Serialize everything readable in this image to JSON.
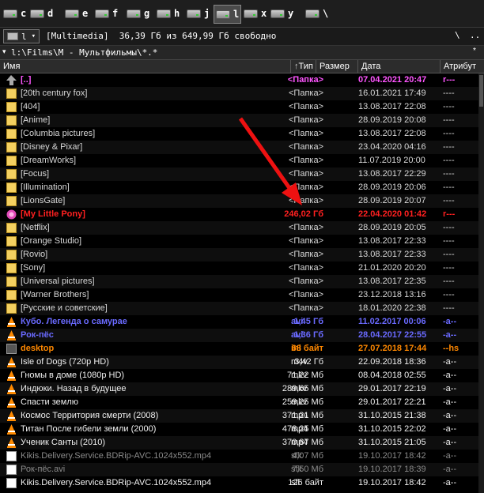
{
  "drives": [
    {
      "letter": "c",
      "active": false
    },
    {
      "letter": "d",
      "active": false
    },
    {
      "letter": "e",
      "active": false
    },
    {
      "letter": "f",
      "active": false
    },
    {
      "letter": "g",
      "active": false
    },
    {
      "letter": "h",
      "active": false
    },
    {
      "letter": "j",
      "active": false
    },
    {
      "letter": "l",
      "active": true
    },
    {
      "letter": "x",
      "active": false
    },
    {
      "letter": "y",
      "active": false
    },
    {
      "letter": "\\",
      "active": false
    }
  ],
  "pathbar": {
    "drive": "l",
    "volume": "[Multimedia]  36,39 Гб из 649,99 Гб свободно",
    "buttons": [
      "\\",
      ".."
    ]
  },
  "current_path": "l:\\Films\\М - Мультфильмы\\*.*",
  "headers": {
    "name": "Имя",
    "ext": "Тип",
    "size": "Размер",
    "date": "Дата",
    "attr": "Атрибут"
  },
  "colors": {
    "folder": "#d8d8d8",
    "folder_size": "#ffffff",
    "up": "#ff55ff",
    "marked": "#ff2020",
    "video_blue": "#6a6aff",
    "hidden": "#ff8800",
    "video": "#f0f0f0",
    "dim": "#8a8a8a",
    "arrow": "#ee1111"
  },
  "files": [
    {
      "name": "[..]",
      "ext": "",
      "size": "<Папка>",
      "date": "07.04.2021 20:47",
      "attr": "r---",
      "icon": "up-icon",
      "color": "up"
    },
    {
      "name": "[20th century fox]",
      "ext": "",
      "size": "<Папка>",
      "date": "16.01.2021 17:49",
      "attr": "----",
      "icon": "folder-icon",
      "color": "folder"
    },
    {
      "name": "[404]",
      "ext": "",
      "size": "<Папка>",
      "date": "13.08.2017 22:08",
      "attr": "----",
      "icon": "folder-icon",
      "color": "folder"
    },
    {
      "name": "[Anime]",
      "ext": "",
      "size": "<Папка>",
      "date": "28.09.2019 20:08",
      "attr": "----",
      "icon": "folder-icon",
      "color": "folder"
    },
    {
      "name": "[Columbia pictures]",
      "ext": "",
      "size": "<Папка>",
      "date": "13.08.2017 22:08",
      "attr": "----",
      "icon": "folder-icon",
      "color": "folder"
    },
    {
      "name": "[Disney & Pixar]",
      "ext": "",
      "size": "<Папка>",
      "date": "23.04.2020 04:16",
      "attr": "----",
      "icon": "folder-icon",
      "color": "folder"
    },
    {
      "name": "[DreamWorks]",
      "ext": "",
      "size": "<Папка>",
      "date": "11.07.2019 20:00",
      "attr": "----",
      "icon": "folder-icon",
      "color": "folder"
    },
    {
      "name": "[Focus]",
      "ext": "",
      "size": "<Папка>",
      "date": "13.08.2017 22:29",
      "attr": "----",
      "icon": "folder-icon",
      "color": "folder"
    },
    {
      "name": "[Illumination]",
      "ext": "",
      "size": "<Папка>",
      "date": "28.09.2019 20:06",
      "attr": "----",
      "icon": "folder-icon",
      "color": "folder"
    },
    {
      "name": "[LionsGate]",
      "ext": "",
      "size": "<Папка>",
      "date": "28.09.2019 20:07",
      "attr": "----",
      "icon": "folder-icon",
      "color": "folder"
    },
    {
      "name": "[My Little Pony]",
      "ext": "",
      "size": "246,02 Гб",
      "date": "22.04.2020 01:42",
      "attr": "r---",
      "icon": "pony-icon",
      "color": "marked"
    },
    {
      "name": "[Netflix]",
      "ext": "",
      "size": "<Папка>",
      "date": "28.09.2019 20:05",
      "attr": "----",
      "icon": "folder-icon",
      "color": "folder"
    },
    {
      "name": "[Orange Studio]",
      "ext": "",
      "size": "<Папка>",
      "date": "13.08.2017 22:33",
      "attr": "----",
      "icon": "folder-icon",
      "color": "folder"
    },
    {
      "name": "[Rovio]",
      "ext": "",
      "size": "<Папка>",
      "date": "13.08.2017 22:33",
      "attr": "----",
      "icon": "folder-icon",
      "color": "folder"
    },
    {
      "name": "[Sony]",
      "ext": "",
      "size": "<Папка>",
      "date": "21.01.2020 20:20",
      "attr": "----",
      "icon": "folder-icon",
      "color": "folder"
    },
    {
      "name": "[Universal pictures]",
      "ext": "",
      "size": "<Папка>",
      "date": "13.08.2017 22:35",
      "attr": "----",
      "icon": "folder-icon",
      "color": "folder"
    },
    {
      "name": "[Warner Brothers]",
      "ext": "",
      "size": "<Папка>",
      "date": "23.12.2018 13:16",
      "attr": "----",
      "icon": "folder-icon",
      "color": "folder"
    },
    {
      "name": "[Русские и советские]",
      "ext": "",
      "size": "<Папка>",
      "date": "18.01.2020 22:38",
      "attr": "----",
      "icon": "folder-icon",
      "color": "folder"
    },
    {
      "name": "Кубо. Легенда о самурае",
      "ext": "avi",
      "size": "1,45 Гб",
      "date": "11.02.2017 00:06",
      "attr": "-a--",
      "icon": "vlc-icon",
      "color": "video_blue"
    },
    {
      "name": "Рок-пёс",
      "ext": "avi",
      "size": "1,36 Гб",
      "date": "28.04.2017 22:55",
      "attr": "-a--",
      "icon": "vlc-icon",
      "color": "video_blue"
    },
    {
      "name": "desktop",
      "ext": "ini",
      "size": "68 байт",
      "date": "27.07.2018 17:44",
      "attr": "--hs",
      "icon": "settings-file-icon",
      "color": "hidden"
    },
    {
      "name": "Isle of Dogs (720p HD)",
      "ext": "m4v",
      "size": "3,42 Гб",
      "date": "22.09.2018 18:36",
      "attr": "-a--",
      "icon": "vlc-icon",
      "color": "video"
    },
    {
      "name": "Гномы в доме (1080p HD)",
      "ext": "mkv",
      "size": "71,22 Мб",
      "date": "08.04.2018 02:55",
      "attr": "-a--",
      "icon": "vlc-icon",
      "color": "video"
    },
    {
      "name": "Индюки. Назад в будущее",
      "ext": "mkv",
      "size": "289,65 Мб",
      "date": "29.01.2017 22:19",
      "attr": "-a--",
      "icon": "vlc-icon",
      "color": "video"
    },
    {
      "name": "Спасти землю",
      "ext": "mkv",
      "size": "259,25 Мб",
      "date": "29.01.2017 22:21",
      "attr": "-a--",
      "icon": "vlc-icon",
      "color": "video"
    },
    {
      "name": "Космос Территория смерти (2008)",
      "ext": "mp4",
      "size": "371,21 Мб",
      "date": "31.10.2015 21:38",
      "attr": "-a--",
      "icon": "vlc-icon",
      "color": "video"
    },
    {
      "name": "Титан После гибели земли (2000)",
      "ext": "mp4",
      "size": "478,25 Мб",
      "date": "31.10.2015 22:02",
      "attr": "-a--",
      "icon": "vlc-icon",
      "color": "video"
    },
    {
      "name": "Ученик Санты (2010)",
      "ext": "mp4",
      "size": "370,87 Мб",
      "date": "31.10.2015 21:05",
      "attr": "-a--",
      "icon": "vlc-icon",
      "color": "video"
    },
    {
      "name": "Kikis.Delivery.Service.BDRip-AVC.1024x552.mp4",
      "ext": "sfk",
      "size": "4,07 Мб",
      "date": "19.10.2017 18:42",
      "attr": "-a--",
      "icon": "file-icon",
      "color": "dim"
    },
    {
      "name": "Рок-пёс.avi",
      "ext": "sfk",
      "size": "7,50 Мб",
      "date": "19.10.2017 18:39",
      "attr": "-a--",
      "icon": "file-icon",
      "color": "dim"
    },
    {
      "name": "Kikis.Delivery.Service.BDRip-AVC.1024x552.mp4",
      "ext": "sfl",
      "size": "126 байт",
      "date": "19.10.2017 18:42",
      "attr": "-a--",
      "icon": "file-icon",
      "color": "video"
    }
  ]
}
